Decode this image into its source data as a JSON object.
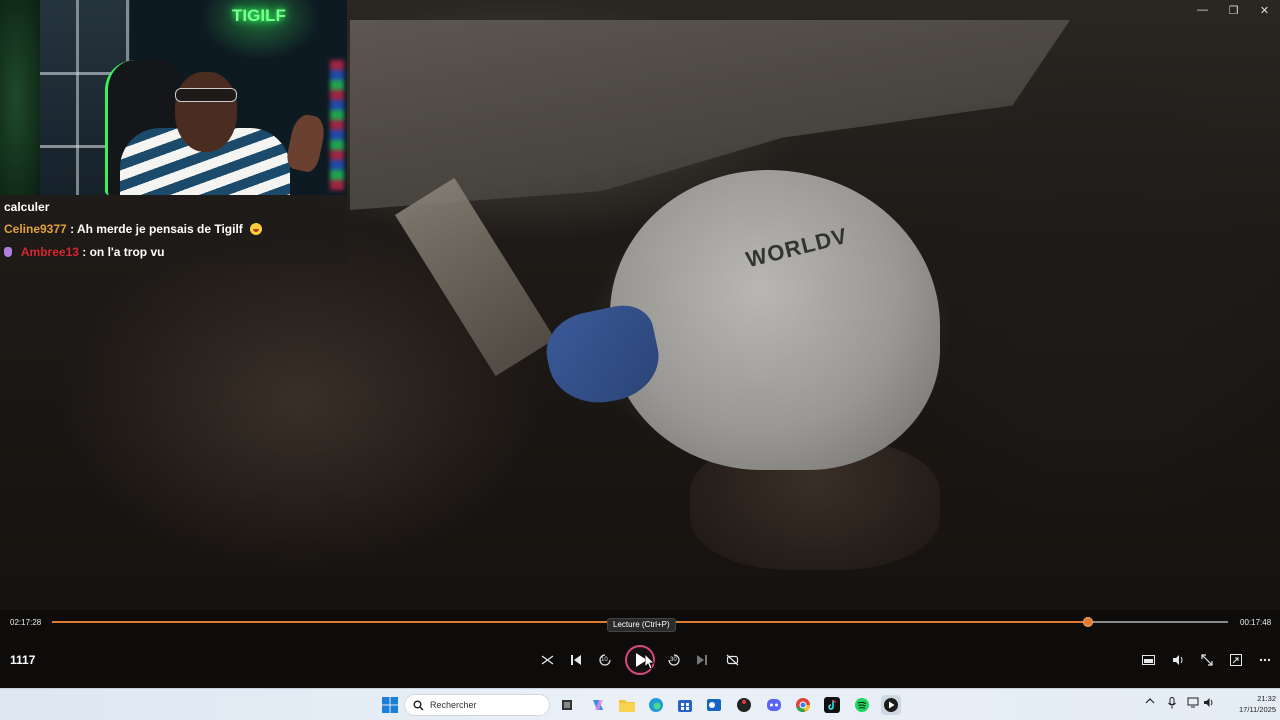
{
  "window": {
    "minimize": "—",
    "maximize": "❐",
    "close": "✕"
  },
  "webcam": {
    "neon_sign": "TIGILF"
  },
  "chat": {
    "top_text": "calculer",
    "messages": [
      {
        "user": "Celine9377",
        "text": ": Ah merde je pensais de Tigilf"
      },
      {
        "user": "Ambree13",
        "text": ": on l'a trop vu"
      }
    ]
  },
  "video": {
    "shirt_text": "WORLDV"
  },
  "player": {
    "elapsed": "02:17:28",
    "remaining": "00:17:48",
    "progress": 0.881,
    "tooltip": "Lecture (Ctrl+P)",
    "counter": "1117",
    "skip_back_label": "10",
    "skip_forward_label": "30"
  },
  "taskbar": {
    "search_placeholder": "Rechercher",
    "time": "21:32",
    "date": "17/11/2025"
  },
  "colors": {
    "seek_accent": "#e07a2e",
    "play_ring": "#e0457a"
  }
}
